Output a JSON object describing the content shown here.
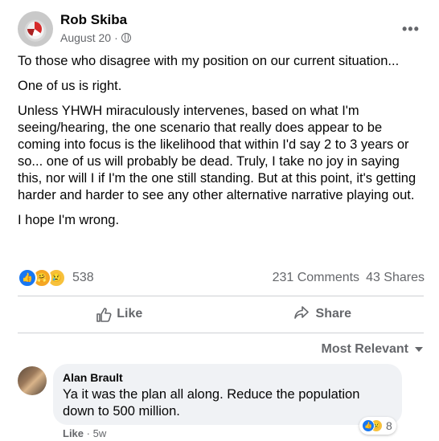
{
  "post": {
    "author": "Rob Skiba",
    "date": "August 20",
    "separator": "·",
    "more_label": "•••",
    "paragraphs": [
      "To those who disagree with my position on our current situation...",
      "One of us is right.",
      "Unless YHWH miraculously intervenes, based on what I'm seeing/hearing, the one scenario that really does appear to be coming into focus is the likelihood that within I'd say 2 to 3 years or so... one of us will probably be dead. Truly, I take no joy in saying this, nor will I if I'm the one still standing. But at this point, it's getting harder and harder to see any other alternative narrative playing out.",
      "I hope I'm wrong."
    ],
    "reactions": {
      "icons": [
        "like-icon",
        "care-icon",
        "sad-icon"
      ],
      "count": "538"
    },
    "comments_count": "231 Comments",
    "shares_count": "43 Shares",
    "actions": {
      "like": "Like",
      "share": "Share"
    },
    "sort": "Most Relevant"
  },
  "comment": {
    "author": "Alan Brault",
    "text": "Ya it was the plan all along. Reduce the population down to 500 million.",
    "reaction_count": "8",
    "like_label": "Like",
    "separator": "·",
    "time": "5w"
  },
  "colors": {
    "secondary_text": "#65676b",
    "bubble": "#f0f2f5",
    "like_blue": "#1877f2"
  }
}
